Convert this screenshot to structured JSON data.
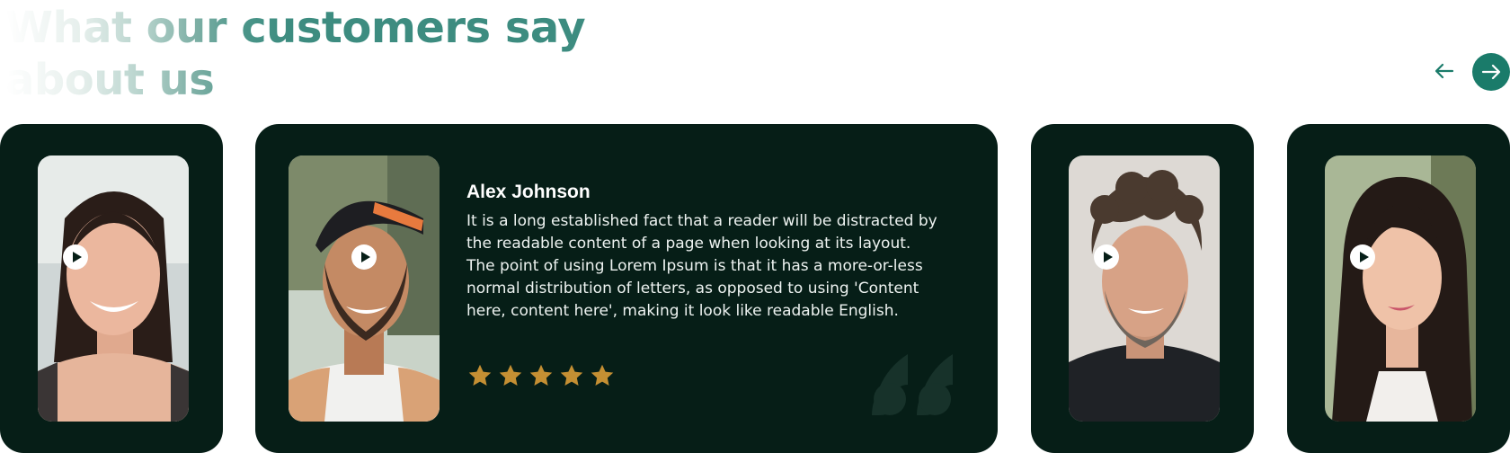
{
  "section": {
    "title_line1": "What our customers say",
    "title_line2": "about us"
  },
  "carousel": {
    "prev_icon": "arrow-left-icon",
    "next_icon": "arrow-right-icon",
    "accent_color": "#1a7b6a",
    "card_color": "#061e17",
    "star_color": "#c48f33"
  },
  "testimonials": [
    {
      "photo": "woman-smiling"
    },
    {
      "name": "Alex Johnson",
      "text": "It is a long established fact that a reader will be distracted by the readable content of a page when looking at its layout. The point of using Lorem Ipsum is that it has a more-or-less normal distribution of letters, as opposed to using 'Content here, content here', making it look like readable English.",
      "rating": 5,
      "photo": "man-backwards-cap"
    },
    {
      "photo": "man-curly-hair"
    },
    {
      "photo": "woman-long-hair"
    }
  ]
}
